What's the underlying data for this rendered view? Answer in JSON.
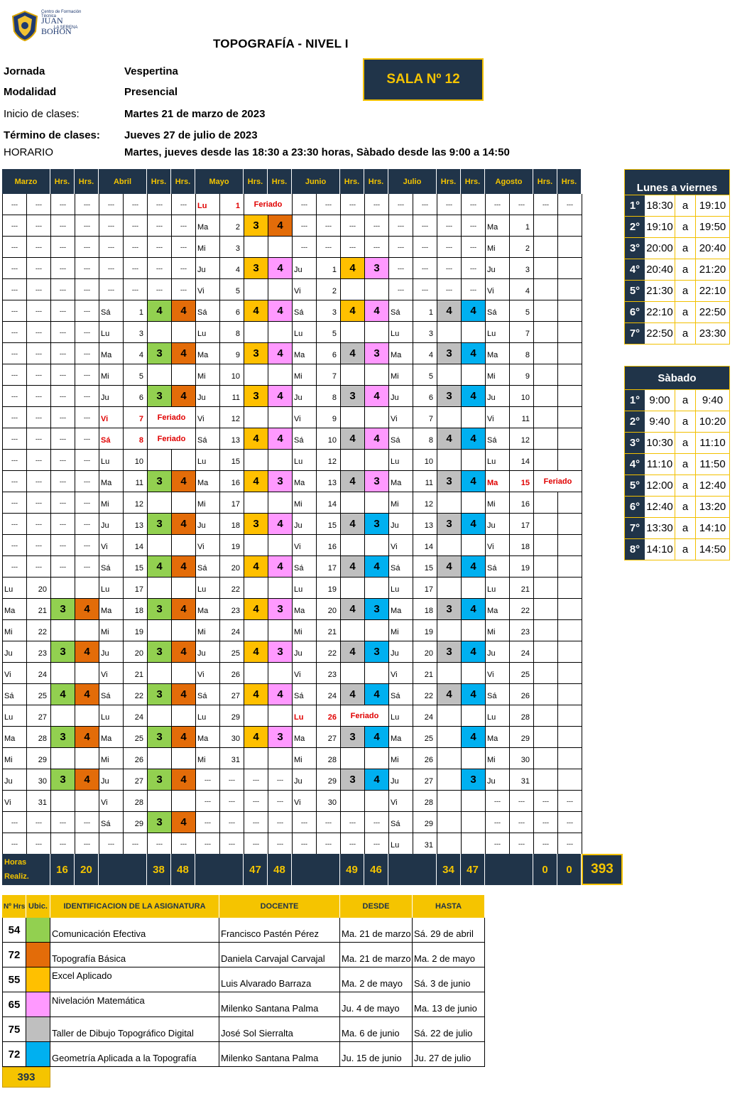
{
  "logo": {
    "line1": "Centro de Formación Técnica",
    "line2": "JUAN BOHON",
    "line3": "LA SERENA"
  },
  "title": "TOPOGRAFÍA - NIVEL  I",
  "info": [
    {
      "label": "Jornada",
      "value": "Vespertina"
    },
    {
      "label": "Modalidad",
      "value": "Presencial"
    },
    {
      "label": "Inicio de clases:",
      "value": "Martes 21 de marzo de 2023"
    },
    {
      "label": "Término de clases:",
      "value": "Jueves 27 de julio de 2023"
    },
    {
      "label": "HORARIO",
      "value": "Martes, jueves desde las 18:30 a 23:30 horas, Sàbado desde las 9:00 a 14:50"
    }
  ],
  "sala": "SALA Nº 12",
  "calendar": {
    "headers": [
      "Marzo",
      "",
      "Hrs.",
      "Hrs.",
      "Abril",
      "",
      "Hrs.",
      "Hrs.",
      "Mayo",
      "",
      "Hrs.",
      "Hrs.",
      "Junio",
      "",
      "Hrs.",
      "Hrs.",
      "Julio",
      "",
      "Hrs.",
      "Hrs.",
      "Agosto",
      "",
      "Hrs.",
      "Hrs."
    ],
    "rows": [
      [
        "---",
        "---",
        "---",
        "---",
        "---",
        "---",
        "---",
        "---",
        "Lu|R",
        "1|R",
        "Feriado|F",
        "",
        "---",
        "---",
        "---",
        "---",
        "---",
        "---",
        "---",
        "---",
        "---",
        "---",
        "---",
        "---"
      ],
      [
        "---",
        "---",
        "---",
        "---",
        "---",
        "---",
        "---",
        "---",
        "Ma",
        "2",
        "3|Y",
        "4|O",
        "---",
        "---",
        "---",
        "---",
        "---",
        "---",
        "---",
        "---",
        "Ma",
        "1",
        "",
        ""
      ],
      [
        "---",
        "---",
        "---",
        "---",
        "---",
        "---",
        "---",
        "---",
        "Mi",
        "3",
        "",
        "",
        "---",
        "---",
        "---",
        "---",
        "---",
        "---",
        "---",
        "---",
        "Mi",
        "2",
        "",
        ""
      ],
      [
        "---",
        "---",
        "---",
        "---",
        "---",
        "---",
        "---",
        "---",
        "Ju",
        "4",
        "3|Y",
        "4|P",
        "Ju",
        "1",
        "4|Y",
        "3|P",
        "---",
        "---",
        "---",
        "---",
        "Ju",
        "3",
        "",
        ""
      ],
      [
        "---",
        "---",
        "---",
        "---",
        "---",
        "---",
        "---",
        "---",
        "Vi",
        "5",
        "",
        "",
        "Vi",
        "2",
        "",
        "",
        "---",
        "---",
        "---",
        "---",
        "Vi",
        "4",
        "",
        ""
      ],
      [
        "---",
        "---",
        "---",
        "---",
        "Sá",
        "1",
        "4|G",
        "4|O",
        "Sá",
        "6",
        "4|Y",
        "4|P",
        "Sá",
        "3",
        "4|Y",
        "4|P",
        "Sá",
        "1",
        "4|S",
        "4|B",
        "Sá",
        "5",
        "",
        ""
      ],
      [
        "---",
        "---",
        "---",
        "---",
        "Lu",
        "3",
        "",
        "",
        "Lu",
        "8",
        "",
        "",
        "Lu",
        "5",
        "",
        "",
        "Lu",
        "3",
        "",
        "",
        "Lu",
        "7",
        "",
        ""
      ],
      [
        "---",
        "---",
        "---",
        "---",
        "Ma",
        "4",
        "3|G",
        "4|O",
        "Ma",
        "9",
        "3|Y",
        "4|P",
        "Ma",
        "6",
        "4|S",
        "3|P",
        "Ma",
        "4",
        "3|S",
        "4|B",
        "Ma",
        "8",
        "",
        ""
      ],
      [
        "---",
        "---",
        "---",
        "---",
        "Mi",
        "5",
        "",
        "",
        "Mi",
        "10",
        "",
        "",
        "Mi",
        "7",
        "",
        "",
        "Mi",
        "5",
        "",
        "",
        "Mi",
        "9",
        "",
        ""
      ],
      [
        "---",
        "---",
        "---",
        "---",
        "Ju",
        "6",
        "3|G",
        "4|O",
        "Ju",
        "11",
        "3|Y",
        "4|P",
        "Ju",
        "8",
        "3|S",
        "4|P",
        "Ju",
        "6",
        "3|S",
        "4|B",
        "Ju",
        "10",
        "",
        ""
      ],
      [
        "---",
        "---",
        "---",
        "---",
        "Vi|R",
        "7|R",
        "Feriado|F",
        "",
        "Vi",
        "12",
        "",
        "",
        "Vi",
        "9",
        "",
        "",
        "Vi",
        "7",
        "",
        "",
        "Vi",
        "11",
        "",
        ""
      ],
      [
        "---",
        "---",
        "---",
        "---",
        "Sá|R",
        "8|R",
        "Feriado|F",
        "",
        "Sá",
        "13",
        "4|Y",
        "4|P",
        "Sá",
        "10",
        "4|S",
        "4|P",
        "Sá",
        "8",
        "4|S",
        "4|B",
        "Sá",
        "12",
        "",
        ""
      ],
      [
        "---",
        "---",
        "---",
        "---",
        "Lu",
        "10",
        "",
        "",
        "Lu",
        "15",
        "",
        "",
        "Lu",
        "12",
        "",
        "",
        "Lu",
        "10",
        "",
        "",
        "Lu",
        "14",
        "",
        ""
      ],
      [
        "---",
        "---",
        "---",
        "---",
        "Ma",
        "11",
        "3|G",
        "4|O",
        "Ma",
        "16",
        "4|Y",
        "3|P",
        "Ma",
        "13",
        "4|S",
        "3|P",
        "Ma",
        "11",
        "3|S",
        "4|B",
        "Ma|R",
        "15|R",
        "Feriado|F",
        ""
      ],
      [
        "---",
        "---",
        "---",
        "---",
        "Mi",
        "12",
        "",
        "",
        "Mi",
        "17",
        "",
        "",
        "Mi",
        "14",
        "",
        "",
        "Mi",
        "12",
        "",
        "",
        "Mi",
        "16",
        "",
        ""
      ],
      [
        "---",
        "---",
        "---",
        "---",
        "Ju",
        "13",
        "3|G",
        "4|O",
        "Ju",
        "18",
        "3|Y",
        "4|P",
        "Ju",
        "15",
        "4|S",
        "3|B",
        "Ju",
        "13",
        "3|S",
        "4|B",
        "Ju",
        "17",
        "",
        ""
      ],
      [
        "---",
        "---",
        "---",
        "---",
        "Vi",
        "14",
        "",
        "",
        "Vi",
        "19",
        "",
        "",
        "Vi",
        "16",
        "",
        "",
        "Vi",
        "14",
        "",
        "",
        "Vi",
        "18",
        "",
        ""
      ],
      [
        "---",
        "---",
        "---",
        "---",
        "Sá",
        "15",
        "4|G",
        "4|O",
        "Sá",
        "20",
        "4|Y",
        "4|P",
        "Sá",
        "17",
        "4|S",
        "4|B",
        "Sá",
        "15",
        "4|S",
        "4|B",
        "Sá",
        "19",
        "",
        ""
      ],
      [
        "Lu",
        "20",
        "",
        "",
        "Lu",
        "17",
        "",
        "",
        "Lu",
        "22",
        "",
        "",
        "Lu",
        "19",
        "",
        "",
        "Lu",
        "17",
        "",
        "",
        "Lu",
        "21",
        "",
        ""
      ],
      [
        "Ma",
        "21",
        "3|G",
        "4|O",
        "Ma",
        "18",
        "3|G",
        "4|O",
        "Ma",
        "23",
        "4|Y",
        "3|P",
        "Ma",
        "20",
        "4|S",
        "3|B",
        "Ma",
        "18",
        "3|S",
        "4|B",
        "Ma",
        "22",
        "",
        ""
      ],
      [
        "Mi",
        "22",
        "",
        "",
        "Mi",
        "19",
        "",
        "",
        "Mi",
        "24",
        "",
        "",
        "Mi",
        "21",
        "",
        "",
        "Mi",
        "19",
        "",
        "",
        "Mi",
        "23",
        "",
        ""
      ],
      [
        "Ju",
        "23",
        "3|G",
        "4|O",
        "Ju",
        "20",
        "3|G",
        "4|O",
        "Ju",
        "25",
        "4|Y",
        "3|P",
        "Ju",
        "22",
        "4|S",
        "3|B",
        "Ju",
        "20",
        "3|S",
        "4|B",
        "Ju",
        "24",
        "",
        ""
      ],
      [
        "Vi",
        "24",
        "",
        "",
        "Vi",
        "21",
        "",
        "",
        "Vi",
        "26",
        "",
        "",
        "Vi",
        "23",
        "",
        "",
        "Vi",
        "21",
        "",
        "",
        "Vi",
        "25",
        "",
        ""
      ],
      [
        "Sá",
        "25",
        "4|G",
        "4|O",
        "Sá",
        "22",
        "3|G",
        "4|O",
        "Sá",
        "27",
        "4|Y",
        "4|P",
        "Sá",
        "24",
        "4|S",
        "4|B",
        "Sá",
        "22",
        "4|S",
        "4|B",
        "Sá",
        "26",
        "",
        ""
      ],
      [
        "Lu",
        "27",
        "",
        "",
        "Lu",
        "24",
        "",
        "",
        "Lu",
        "29",
        "",
        "",
        "Lu|R",
        "26|R",
        "Feriado|F",
        "",
        "Lu",
        "24",
        "",
        "",
        "Lu",
        "28",
        "",
        ""
      ],
      [
        "Ma",
        "28",
        "3|G",
        "4|O",
        "Ma",
        "25",
        "3|G",
        "4|O",
        "Ma",
        "30",
        "4|Y",
        "3|P",
        "Ma",
        "27",
        "3|S",
        "4|B",
        "Ma",
        "25",
        "",
        "4|B",
        "Ma",
        "29",
        "",
        ""
      ],
      [
        "Mi",
        "29",
        "",
        "",
        "Mi",
        "26",
        "",
        "",
        "Mi",
        "31",
        "",
        "",
        "Mi",
        "28",
        "",
        "",
        "Mi",
        "26",
        "",
        "",
        "Mi",
        "30",
        "",
        ""
      ],
      [
        "Ju",
        "30",
        "3|G",
        "4|O",
        "Ju",
        "27",
        "3|G",
        "4|O",
        "---",
        "---",
        "---",
        "---",
        "Ju",
        "29",
        "3|S",
        "4|B",
        "Ju",
        "27",
        "",
        "3|B",
        "Ju",
        "31",
        "",
        ""
      ],
      [
        "Vi",
        "31",
        "",
        "",
        "Vi",
        "28",
        "",
        "",
        "---",
        "---",
        "---",
        "---",
        "Vi",
        "30",
        "",
        "",
        "Vi",
        "28",
        "",
        "",
        "---",
        "---",
        "---",
        "---"
      ],
      [
        "---",
        "---",
        "---",
        "---",
        "Sá",
        "29",
        "3|G",
        "4|O",
        "---",
        "---",
        "---",
        "---",
        "---",
        "---",
        "---",
        "---",
        "Sá",
        "29",
        "",
        "",
        "---",
        "---",
        "---",
        "---"
      ],
      [
        "---",
        "---",
        "---",
        "---",
        "---",
        "---",
        "---",
        "---",
        "---",
        "---",
        "---",
        "---",
        "---",
        "---",
        "---",
        "---",
        "Lu",
        "31",
        "",
        "",
        "---",
        "---",
        "---",
        "---"
      ]
    ],
    "totals": {
      "label1": "Horas",
      "label2": "Realiz.",
      "values": [
        "16",
        "20",
        "38",
        "48",
        "47",
        "48",
        "49",
        "46",
        "34",
        "47",
        "0",
        "0"
      ],
      "grand": "393"
    }
  },
  "colors": {
    "G": "#92d050",
    "O": "#e36c09",
    "Y": "#ffc000",
    "P": "#ff99ff",
    "S": "#bfbfbf",
    "B": "#00b0f0",
    "navy": "#203449",
    "gold": "#f5c400",
    "red": "#e00000"
  },
  "weekday_schedule": {
    "title": "Lunes a viernes",
    "rows": [
      {
        "idx": "1°",
        "from": "18:30",
        "a": "a",
        "to": "19:10"
      },
      {
        "idx": "2°",
        "from": "19:10",
        "a": "a",
        "to": "19:50"
      },
      {
        "idx": "3°",
        "from": "20:00",
        "a": "a",
        "to": "20:40"
      },
      {
        "idx": "4°",
        "from": "20:40",
        "a": "a",
        "to": "21:20"
      },
      {
        "idx": "5°",
        "from": "21:30",
        "a": "a",
        "to": "22:10"
      },
      {
        "idx": "6°",
        "from": "22:10",
        "a": "a",
        "to": "22:50"
      },
      {
        "idx": "7°",
        "from": "22:50",
        "a": "a",
        "to": "23:30"
      }
    ]
  },
  "saturday_schedule": {
    "title": "Sàbado",
    "rows": [
      {
        "idx": "1°",
        "from": "9:00",
        "a": "a",
        "to": "9:40"
      },
      {
        "idx": "2°",
        "from": "9:40",
        "a": "a",
        "to": "10:20"
      },
      {
        "idx": "3°",
        "from": "10:30",
        "a": "a",
        "to": "11:10"
      },
      {
        "idx": "4°",
        "from": "11:10",
        "a": "a",
        "to": "11:50"
      },
      {
        "idx": "5°",
        "from": "12:00",
        "a": "a",
        "to": "12:40"
      },
      {
        "idx": "6°",
        "from": "12:40",
        "a": "a",
        "to": "13:20"
      },
      {
        "idx": "7°",
        "from": "13:30",
        "a": "a",
        "to": "14:10"
      },
      {
        "idx": "8°",
        "from": "14:10",
        "a": "a",
        "to": "14:50"
      }
    ]
  },
  "subjects": {
    "headers": [
      "Nº Hrs",
      "Ubic.",
      "IDENTIFICACION DE LA ASIGNATURA",
      "DOCENTE",
      "DESDE",
      "HASTA"
    ],
    "rows": [
      {
        "hrs": "54",
        "color": "G",
        "name": "Comunicación Efectiva",
        "docente": "Francisco Pastén Pérez",
        "desde": "Ma. 21 de marzo",
        "hasta": "Sá. 29 de abril"
      },
      {
        "hrs": "72",
        "color": "O",
        "name": "Topografía Básica",
        "docente": "Daniela Carvajal Carvajal",
        "desde": "Ma. 21 de marzo",
        "hasta": "Ma. 2 de mayo"
      },
      {
        "hrs": "55",
        "color": "Y",
        "name": "Excel Aplicado",
        "docente": "Luis Alvarado Barraza",
        "desde": "Ma. 2 de mayo",
        "hasta": "Sá. 3 de junio"
      },
      {
        "hrs": "65",
        "color": "P",
        "name": "Nivelación Matemática",
        "docente": "Milenko Santana Palma",
        "desde": "Ju. 4 de mayo",
        "hasta": "Ma. 13 de junio"
      },
      {
        "hrs": "75",
        "color": "S",
        "name": "Taller de Dibujo Topográfico Digital",
        "docente": "José Sol Sierralta",
        "desde": "Ma. 6 de junio",
        "hasta": "Sá. 22 de julio"
      },
      {
        "hrs": "72",
        "color": "B",
        "name": "Geometría Aplicada a la Topografía",
        "docente": "Milenko Santana Palma",
        "desde": "Ju. 15 de junio",
        "hasta": "Ju. 27 de julio"
      }
    ],
    "total": "393"
  }
}
